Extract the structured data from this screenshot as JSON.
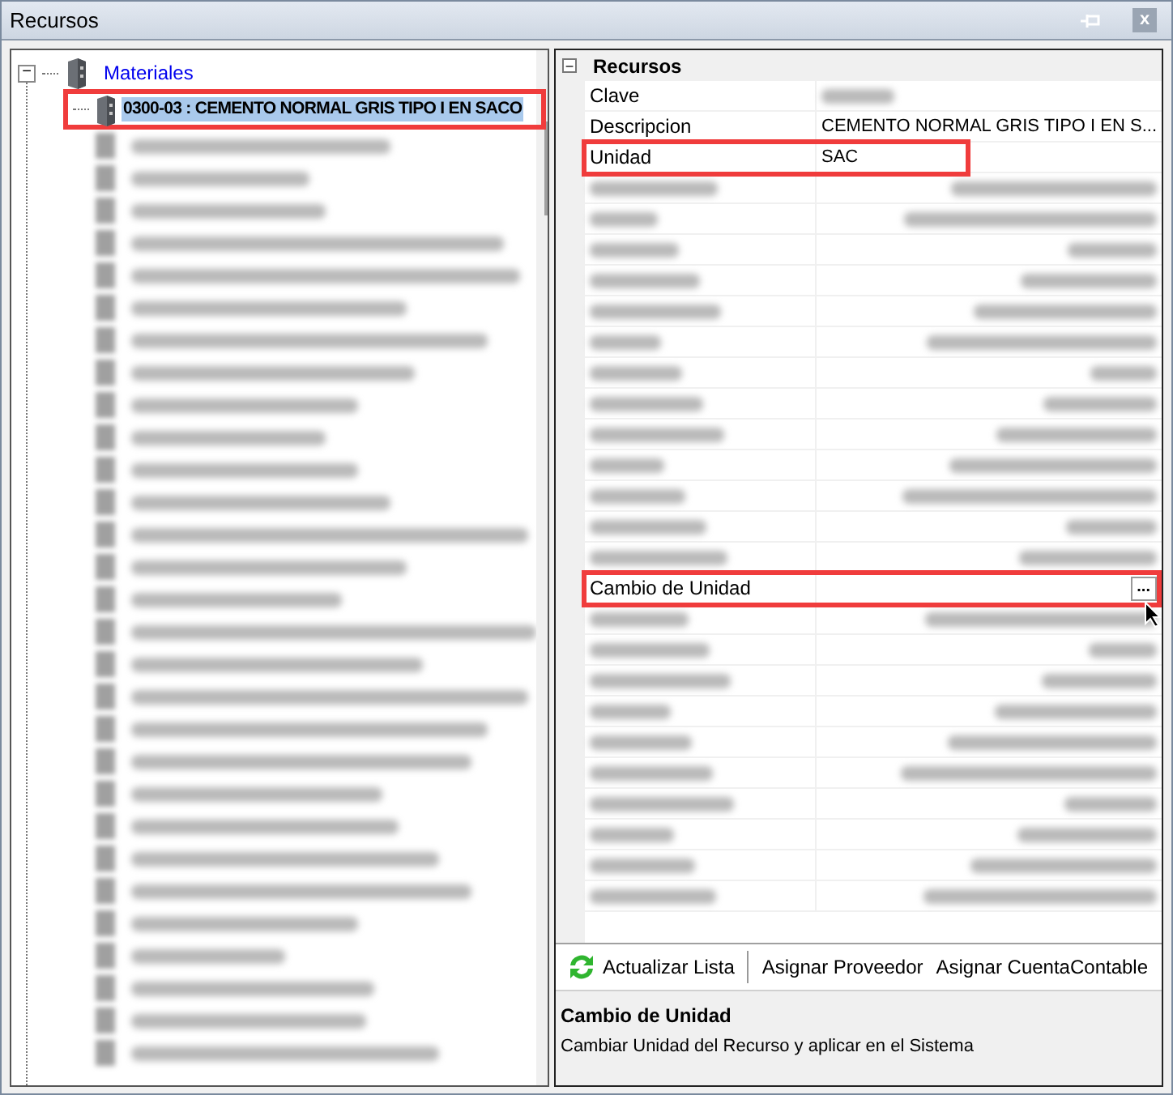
{
  "window": {
    "title": "Recursos",
    "close": "x"
  },
  "tree": {
    "root": {
      "label": "Materiales",
      "expanded": true,
      "expander": "−",
      "children": [
        {
          "kind": "item",
          "label": "0300-03 : CEMENTO NORMAL GRIS TIPO I EN SACO",
          "selected": true,
          "highlighted": true
        },
        {
          "kind": "blurred"
        },
        {
          "kind": "blurred"
        },
        {
          "kind": "blurred"
        },
        {
          "kind": "blurred"
        },
        {
          "kind": "blurred"
        },
        {
          "kind": "blurred"
        },
        {
          "kind": "blurred"
        },
        {
          "kind": "blurred"
        },
        {
          "kind": "blurred"
        },
        {
          "kind": "blurred"
        },
        {
          "kind": "blurred"
        },
        {
          "kind": "blurred"
        },
        {
          "kind": "blurred"
        },
        {
          "kind": "blurred"
        },
        {
          "kind": "blurred"
        },
        {
          "kind": "blurred"
        },
        {
          "kind": "blurred"
        },
        {
          "kind": "blurred"
        },
        {
          "kind": "blurred"
        },
        {
          "kind": "blurred"
        },
        {
          "kind": "blurred"
        },
        {
          "kind": "blurred"
        },
        {
          "kind": "blurred"
        },
        {
          "kind": "blurred"
        },
        {
          "kind": "blurred"
        },
        {
          "kind": "blurred"
        },
        {
          "kind": "blurred"
        },
        {
          "kind": "blurred"
        },
        {
          "kind": "blurred"
        }
      ]
    }
  },
  "property_grid": {
    "category": {
      "label": "Recursos",
      "expanded": true,
      "expander": "−"
    },
    "rows": [
      {
        "kind": "blurred_value",
        "label": "Clave",
        "highlighted": false
      },
      {
        "kind": "text",
        "label": "Descripcion",
        "value": "CEMENTO NORMAL GRIS TIPO I EN S...",
        "highlighted": false
      },
      {
        "kind": "text",
        "label": "Unidad",
        "value": "SAC",
        "highlighted": true
      },
      {
        "kind": "blurred"
      },
      {
        "kind": "blurred"
      },
      {
        "kind": "blurred"
      },
      {
        "kind": "blurred"
      },
      {
        "kind": "blurred"
      },
      {
        "kind": "blurred"
      },
      {
        "kind": "blurred"
      },
      {
        "kind": "blurred"
      },
      {
        "kind": "blurred"
      },
      {
        "kind": "blurred"
      },
      {
        "kind": "blurred"
      },
      {
        "kind": "blurred"
      },
      {
        "kind": "blurred"
      },
      {
        "kind": "button",
        "label": "Cambio de Unidad",
        "button": "...",
        "highlighted": true
      },
      {
        "kind": "blurred"
      },
      {
        "kind": "blurred"
      },
      {
        "kind": "blurred"
      },
      {
        "kind": "blurred"
      },
      {
        "kind": "blurred"
      },
      {
        "kind": "blurred"
      },
      {
        "kind": "blurred"
      },
      {
        "kind": "blurred"
      },
      {
        "kind": "blurred"
      },
      {
        "kind": "blurred"
      }
    ]
  },
  "toolbar": [
    {
      "kind": "refresh",
      "label": "Actualizar Lista"
    },
    {
      "kind": "separator"
    },
    {
      "kind": "plain",
      "label": "Asignar Proveedor"
    },
    {
      "kind": "plain",
      "label": "Asignar CuentaContable"
    }
  ],
  "description": {
    "title": "Cambio de Unidad",
    "text": "Cambiar Unidad del Recurso y aplicar en el Sistema"
  }
}
